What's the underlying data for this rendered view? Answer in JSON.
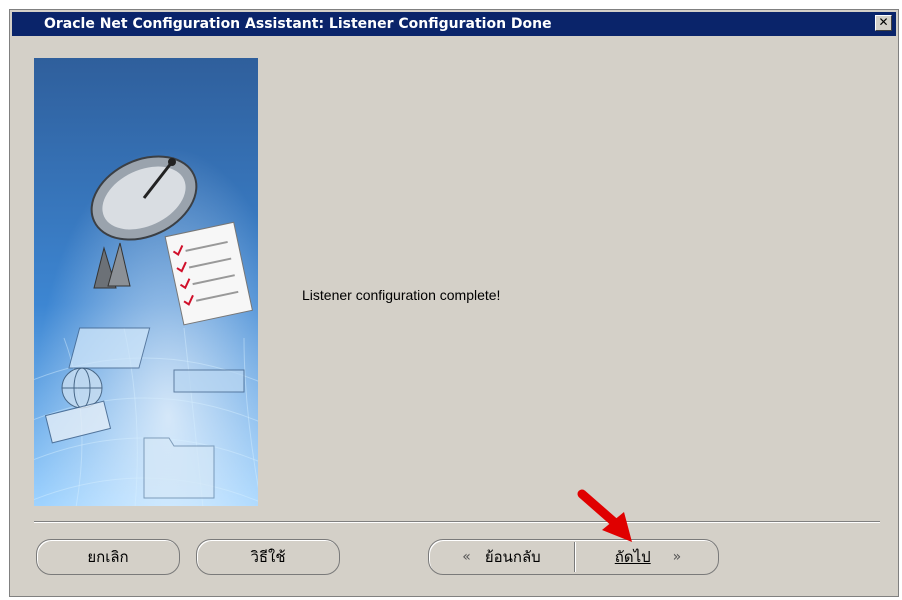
{
  "window": {
    "title": "Oracle Net Configuration Assistant: Listener Configuration Done",
    "close_symbol": "✕"
  },
  "main": {
    "message": "Listener configuration complete!"
  },
  "buttons": {
    "cancel_label": "ยกเลิก",
    "help_label": "วิธีใช้",
    "back_label": "ย้อนกลับ",
    "back_icon": "«",
    "next_label": "ถัดไป",
    "next_icon": "»"
  },
  "colors": {
    "titlebar": "#0a246a",
    "dialog_bg": "#d4d0c8",
    "annotation_arrow": "#e00000"
  }
}
